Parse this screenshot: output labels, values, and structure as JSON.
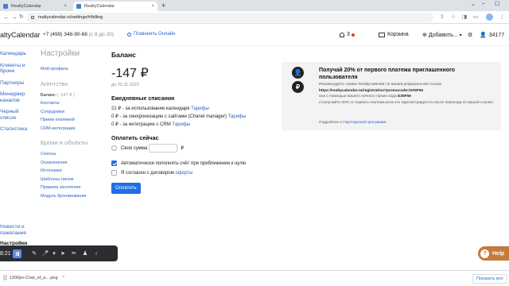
{
  "browser": {
    "tabs": [
      {
        "label": "RealtyCalendar",
        "close": "×"
      },
      {
        "label": "RealtyCalendar",
        "close": "×"
      }
    ],
    "new_tab": "+",
    "window_controls": [
      "⌄",
      "–",
      "☐"
    ],
    "url": "realtycalendar.ru/settings/#/billing",
    "nav": {
      "back": "←",
      "forward": "→",
      "reload": "↻"
    }
  },
  "header": {
    "logo": "altyCalendar",
    "phone": "+7 (499) 348-90-68",
    "phone_hours": "(с 8 до 20)",
    "call_me": "Позвонить Онлайн",
    "notifications_count": "3",
    "cart": "Корзина",
    "add": "Добавить...",
    "user_id": "34177"
  },
  "left_menu": {
    "items": [
      "Календарь",
      "Клиенты и брони",
      "Партнеры",
      "Менеджер каналов",
      "Черный список",
      "Статистика"
    ],
    "bottom": [
      "Новости и пожелания"
    ],
    "active": "Настройки"
  },
  "settings_menu": {
    "title": "Настройки",
    "profile": "Мой профиль",
    "agency_title": "Агентство",
    "agency_items": [
      {
        "label": "Баланс",
        "extra": "( -147 ₽ )"
      },
      {
        "label": "Контакты"
      },
      {
        "label": "Сотрудники"
      },
      {
        "label": "Прием платежей"
      },
      {
        "label": "CRM-интеграции"
      }
    ],
    "bookings_title": "Брони и объекты",
    "bookings_items": [
      "Сезоны",
      "Ограничения",
      "Источники",
      "Шаблоны писем",
      "Правила заселения",
      "Модуль бронирования"
    ]
  },
  "billing": {
    "title": "Баланс",
    "amount": "-147 ₽",
    "date": "до 22.11.2022",
    "daily_title": "Ежедневные списания",
    "charges": [
      {
        "text": "21 ₽ - за использование календаря",
        "link": "Тарифы"
      },
      {
        "text": "0 ₽ - за синхронизацию с сайтами (Chanel manager)",
        "link": "Тарифы"
      },
      {
        "text": "0 ₽ - за интеграцию с CRM",
        "link": "Тарифы"
      }
    ],
    "pay_title": "Оплатить сейчас",
    "custom_sum_label": "Своя сумма",
    "currency": "₽",
    "autopay_label": "Автоматически пополнять счёт при приближении к нулю",
    "agree_text": "Я согласен с договором",
    "agree_link": "оферты",
    "pay_button": "Оплатить"
  },
  "promo": {
    "title": "Получай 20% от первого платежа приглашенного пользователя",
    "line1": "Рекомендуйте сервис RealtyCalendar по вашей реферальной ссылке",
    "link": "https://realtycalendar.ru/registration?promocode=D25F56",
    "line2_pre": "или с помощью вашего личного промо кода",
    "promocode": "D25F56",
    "line3": "и получайте 20% от первого платежа всех кто зарегистрируется после перехода по вашей ссылке.",
    "more_pre": "Подробнее о",
    "more_link": "Партнерской программе",
    "icon_user": "👤",
    "icon_ruble": "₽"
  },
  "recorder": {
    "time": "8:21",
    "tools": [
      "✎",
      "🎤",
      "▾",
      "➤",
      "✏",
      "♟",
      "‹"
    ]
  },
  "help": {
    "label": "Help",
    "icon": "?"
  },
  "downloads": {
    "file": "1200px-Coat_of_a....png",
    "chevron": "^",
    "show_all": "Показать все"
  }
}
